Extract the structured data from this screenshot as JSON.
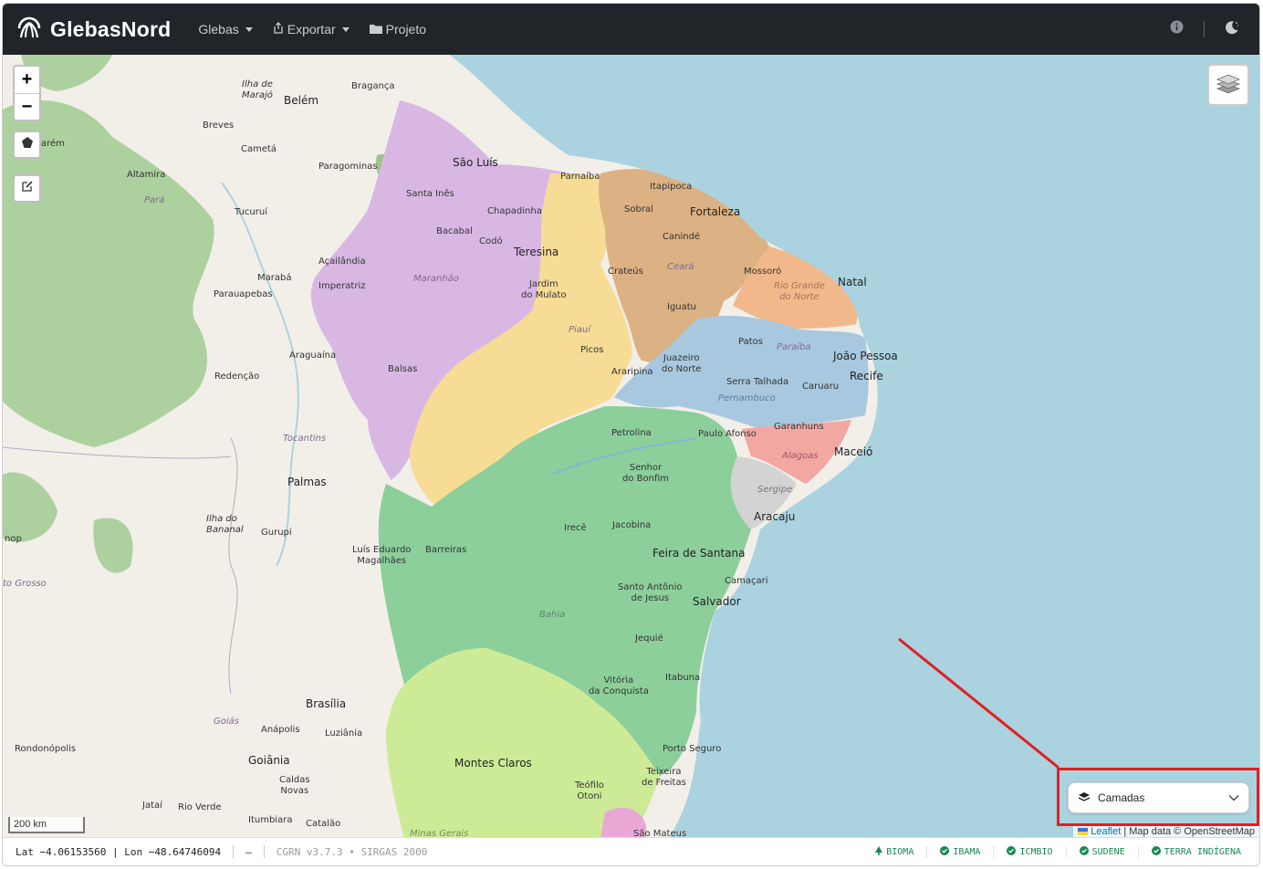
{
  "navbar": {
    "brand": "GlebasNord",
    "menu_glebas": "Glebas",
    "menu_exportar": "Exportar",
    "menu_projeto": "Projeto"
  },
  "map": {
    "zoom_in": "+",
    "zoom_out": "−",
    "scale": "200 km",
    "attribution_leaflet": "Leaflet",
    "attribution_rest": "| Map data © OpenStreetMap",
    "labels": {
      "ilha_marajo": "Ilha de\nMarajó",
      "belem": "Belém",
      "braganca": "Bragança",
      "breves": "Breves",
      "santarem": "arém",
      "cameta": "Cametá",
      "paragominas": "Paragominas",
      "sao_luis": "São Luís",
      "parnaiba": "Parnaíba",
      "altamira": "Altamira",
      "para": "Pará",
      "santa_ines": "Santa Inês",
      "itapipoca": "Itapipoca",
      "chapadinha": "Chapadinha",
      "sobral": "Sobral",
      "fortaleza": "Fortaleza",
      "tucurui": "Tucuruí",
      "bacabal": "Bacabal",
      "coda": "Codó",
      "caninde": "Canindé",
      "teresina": "Teresina",
      "acailandia": "Açailândia",
      "marabá": "Marabá",
      "maranhao": "Maranhão",
      "crateus": "Crateús",
      "ceara": "Ceará",
      "mossoro": "Mossoró",
      "imperatriz": "Imperatriz",
      "jardim_mulato": "Jardim\ndo Mulato",
      "rio_grande_norte": "Rio Grande\ndo Norte",
      "natal": "Natal",
      "parauapebas": "Parauapebas",
      "iguatu": "Iguatu",
      "piaui": "Piauí",
      "patos": "Patos",
      "paraiba": "Paraíba",
      "picos": "Picos",
      "joao_pessoa": "João Pessoa",
      "araguaina": "Araguaína",
      "juazeiro": "Juazeiro\ndo Norte",
      "balsas": "Balsas",
      "araripina": "Araripina",
      "redencao": "Redenção",
      "serra_talhada": "Serra Talhada",
      "recife": "Recife",
      "caruaru": "Caruaru",
      "pernambuco": "Pernambuco",
      "garanhuns": "Garanhuns",
      "petrolina": "Petrolina",
      "paulo_afonso": "Paulo Afonso",
      "tocantins": "Tocantins",
      "alagoas": "Alagoas",
      "maceio": "Maceió",
      "senhor_bonfim": "Senhor\ndo Bonfim",
      "palmas": "Palmas",
      "sergipe": "Sergipe",
      "aracaju": "Aracaju",
      "ilha_bananal": "Ilha do\nBananal",
      "irece": "Irecê",
      "jacobina": "Jacobina",
      "gurupi": "Gurupi",
      "sinop": "nop",
      "luis_eduardo": "Luís Eduardo\nMagalhães",
      "barreiras": "Barreiras",
      "feira": "Feira de Santana",
      "mato_grosso": "to Grosso",
      "camacari": "Camaçari",
      "santo_antonio": "Santo Antônio\nde Jesus",
      "salvador": "Salvador",
      "bahia": "Bahia",
      "jequie": "Jequié",
      "vitoria_conquista": "Vitória\nda Conquista",
      "itabuna": "Itabuna",
      "brasilia": "Brasília",
      "goias": "Goiás",
      "anapolis": "Anápolis",
      "luziania": "Luziânia",
      "rondonopolis": "Rondonópolis",
      "porto_seguro": "Porto Seguro",
      "goiania": "Goiânia",
      "montes_claros": "Montes Claros",
      "teixeira": "Teixeira\nde Freitas",
      "caldas_novas": "Caldas\nNovas",
      "teofilo_otoni": "Teófilo\nOtoni",
      "jatai": "Jataí",
      "rio_verde": "Rio Verde",
      "itumbiara": "Itumbiara",
      "catalao": "Catalão",
      "minas_gerais": "Minas Gerais",
      "sao_mateus": "São Mateus"
    }
  },
  "layers_control": {
    "label": "Camadas"
  },
  "statusbar": {
    "coords": "Lat −4.06153560 | Lon −48.64746094",
    "dash": "—",
    "version": "CGRN v3.7.3 • SIRGAS 2000",
    "badges": [
      "BIOMA",
      "IBAMA",
      "ICMBIO",
      "SUDENE",
      "TERRA INDÍGENA"
    ]
  },
  "colors": {
    "navbar": "#212529",
    "ocean": "#aad3df",
    "land": "#f2efe9",
    "forest": "#add19e",
    "maranhao": "#d8b8e3",
    "piaui": "#f7dc95",
    "ceara": "#dcb183",
    "rn": "#f1b98b",
    "paraiba_pe": "#a8c8df",
    "alagoas": "#f2a7a3",
    "sergipe": "#cfcfcf",
    "bahia": "#8ccf9b",
    "minas": "#cdeb96",
    "badge_green": "#198754",
    "highlight_red": "#e02020"
  }
}
